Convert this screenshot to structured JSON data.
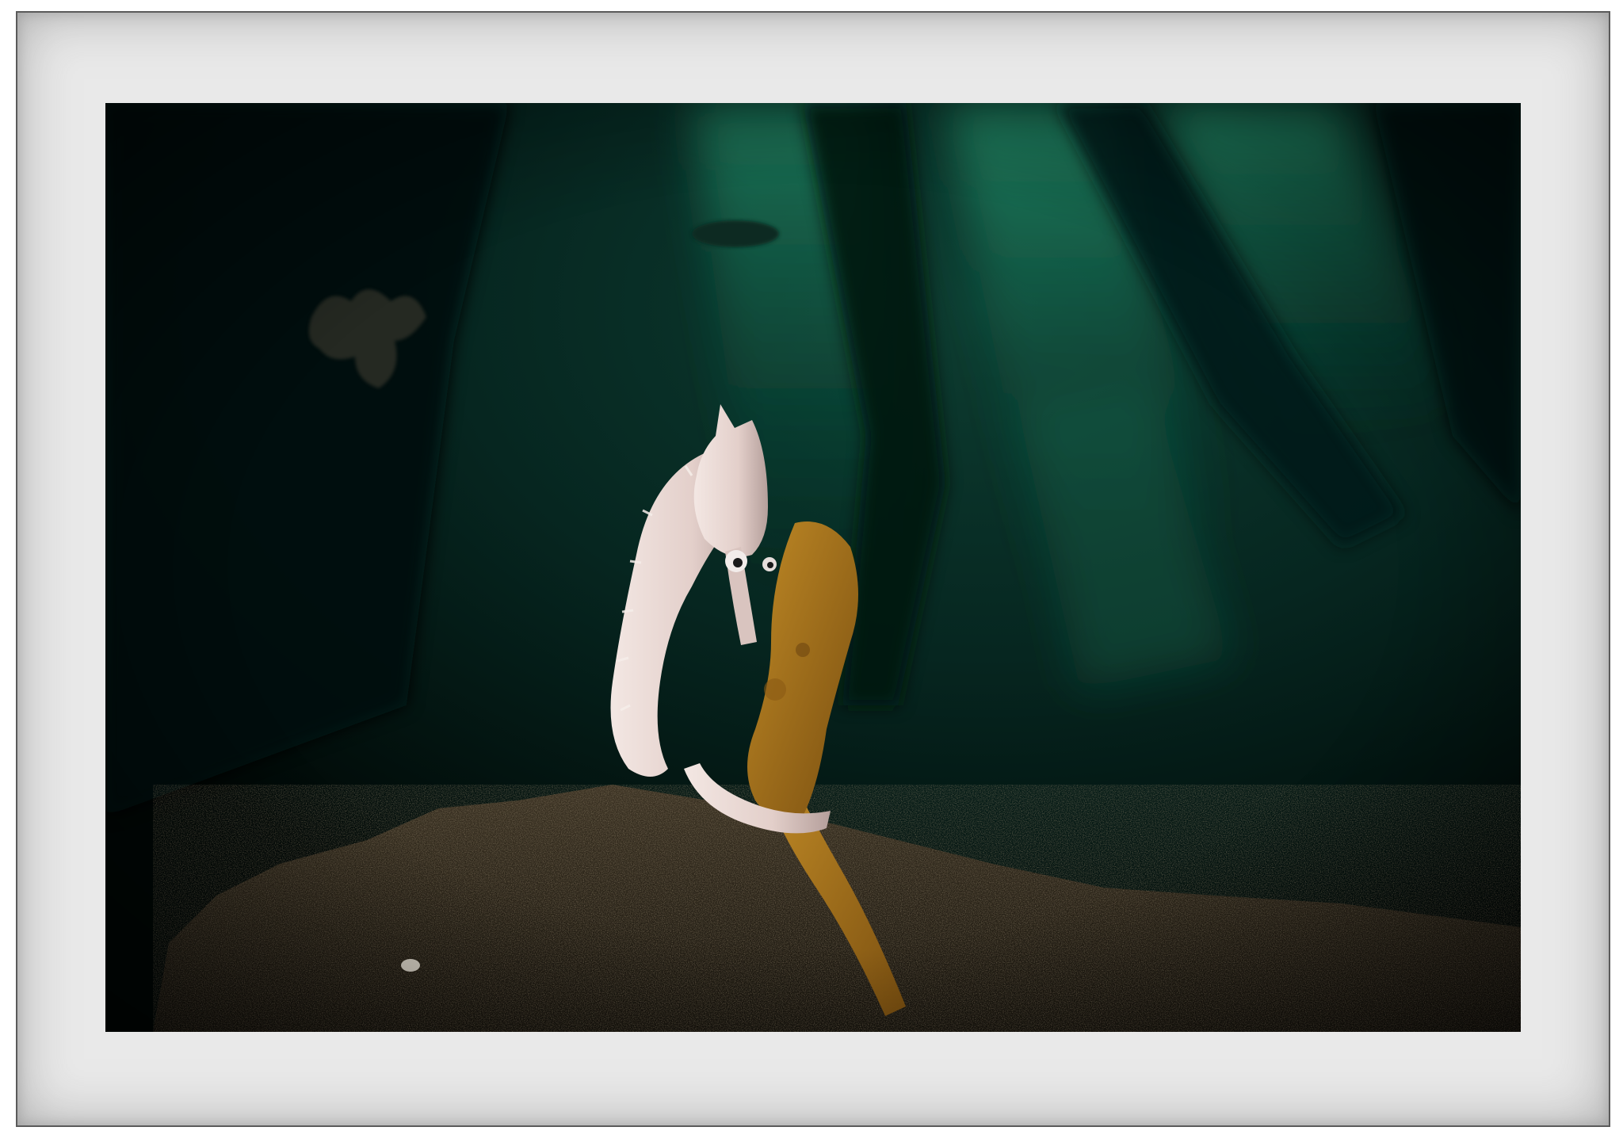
{
  "image": {
    "subject": "seahorse",
    "colors": {
      "mat": "#e9e9e9",
      "frame_line": "#5a5a5a",
      "background_dark": "#02100d",
      "light_beam": "#1f8f68",
      "seahorse": "#e8d6d2",
      "kelp_stalk": "#b07a1e",
      "seabed": "#3b3223"
    }
  }
}
